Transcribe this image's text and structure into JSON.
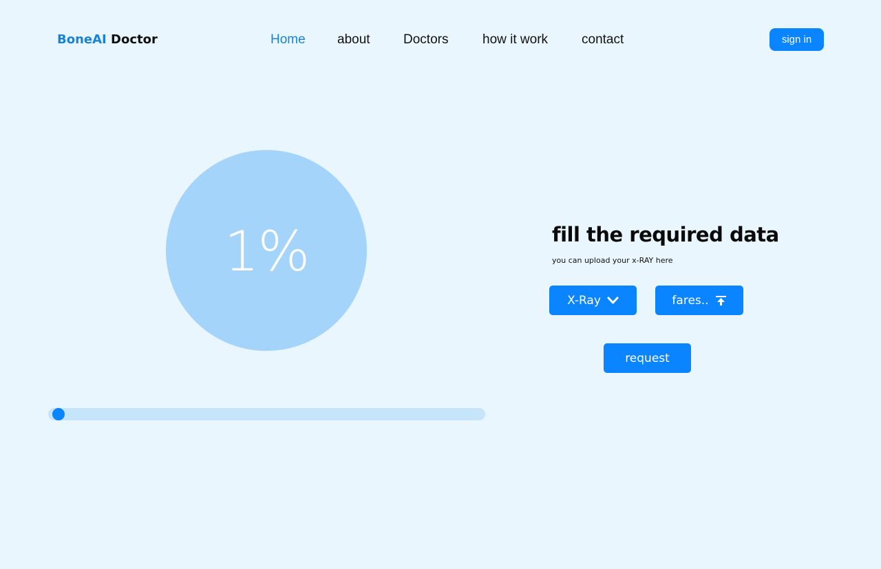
{
  "header": {
    "logo_brand": "BoneAI",
    "logo_rest": "Doctor",
    "nav": [
      {
        "label": "Home",
        "active": true
      },
      {
        "label": "about",
        "active": false
      },
      {
        "label": "Doctors",
        "active": false
      },
      {
        "label": "how it work",
        "active": false
      },
      {
        "label": "contact",
        "active": false
      }
    ],
    "signin_label": "sign in"
  },
  "progress": {
    "percent_text": "1%",
    "value_percent": 1
  },
  "form": {
    "heading": "fill the required data",
    "subtext": "you can upload your x-RAY here",
    "type_select": {
      "value": "X-Ray",
      "icon": "chevron-down-icon"
    },
    "file_upload": {
      "label": "fares..",
      "icon": "upload-icon"
    },
    "request_label": "request"
  },
  "colors": {
    "background": "#eaf6fd",
    "accent": "#0a84ff",
    "brand": "#1883d6",
    "circle": "#a5d4fb",
    "track": "#c6e5fb"
  }
}
